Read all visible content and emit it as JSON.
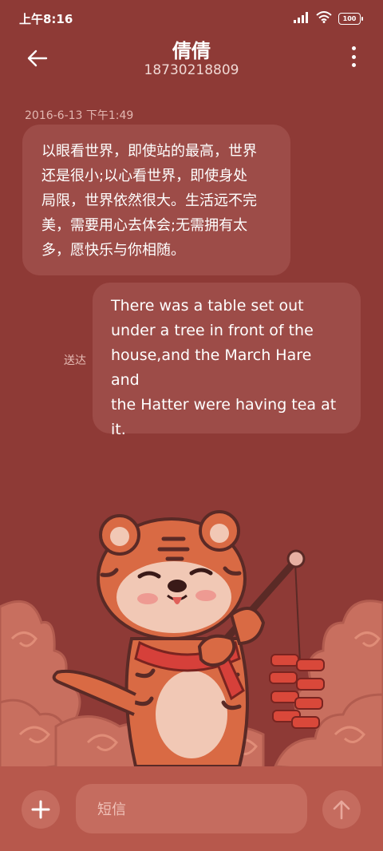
{
  "status_bar": {
    "time": "上午8:16",
    "battery": "100",
    "icons": [
      "signal-icon",
      "wifi-icon",
      "battery-icon"
    ]
  },
  "header": {
    "contact_name": "倩倩",
    "contact_number": "18730218809",
    "back_icon": "back-arrow-icon",
    "more_icon": "more-vertical-icon"
  },
  "conversation": {
    "timestamp": "2016-6-13 下午1:49",
    "messages": [
      {
        "direction": "incoming",
        "lines": [
          "以眼看世界，即使站的最高，世界",
          "还是很小;以心看世界，即使身处",
          "局限，世界依然很大。生活远不完",
          "美，需要用心去体会;无需拥有太",
          "多，愿快乐与你相随。"
        ]
      },
      {
        "direction": "outgoing",
        "status": "送达",
        "lines": [
          "There was a table set out",
          "under a tree in front of the",
          "house,and the March Hare and",
          "the Hatter were having tea at",
          "it."
        ]
      }
    ]
  },
  "composer": {
    "placeholder": "短信",
    "add_icon": "plus-icon",
    "send_icon": "send-arrow-icon"
  },
  "colors": {
    "background": "#8e3a36",
    "bubble": "#9d4c48",
    "bottom_bar": "#b7584c",
    "input": "#c56c5f"
  }
}
